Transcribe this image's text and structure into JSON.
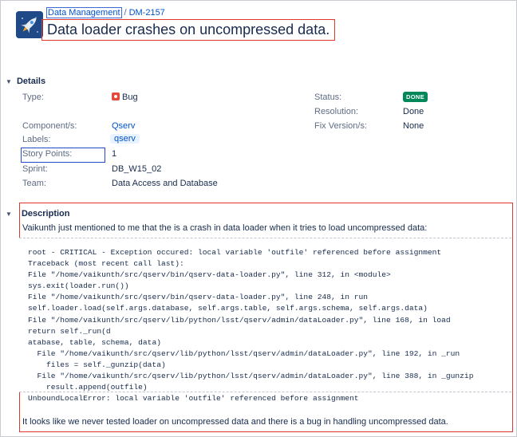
{
  "breadcrumb": {
    "project": "Data Management",
    "separator": "/",
    "issue_key": "DM-2157"
  },
  "issue": {
    "title": "Data loader crashes on uncompressed data."
  },
  "details": {
    "heading": "Details",
    "type_label": "Type:",
    "type_value": "Bug",
    "component_label": "Component/s:",
    "component_value": "Qserv",
    "labels_label": "Labels:",
    "labels_value": "qserv",
    "story_points_label": "Story Points:",
    "story_points_value": "1",
    "sprint_label": "Sprint:",
    "sprint_value": "DB_W15_02",
    "team_label": "Team:",
    "team_value": "Data Access and Database",
    "status_label": "Status:",
    "status_value": "DONE",
    "resolution_label": "Resolution:",
    "resolution_value": "Done",
    "fix_label": "Fix Version/s:",
    "fix_value": "None"
  },
  "description": {
    "heading": "Description",
    "intro": "Vaikunth just mentioned to me that the is a crash in data loader when it tries to load uncompressed data:",
    "code_lines": [
      "root - CRITICAL - Exception occured: local variable 'outfile' referenced before assignment",
      "Traceback (most recent call last):",
      "File \"/home/vaikunth/src/qserv/bin/qserv-data-loader.py\", line 312, in <module>",
      "sys.exit(loader.run())",
      "File \"/home/vaikunth/src/qserv/bin/qserv-data-loader.py\", line 248, in run",
      "self.loader.load(self.args.database, self.args.table, self.args.schema, self.args.data)",
      "File \"/home/vaikunth/src/qserv/lib/python/lsst/qserv/admin/dataLoader.py\", line 168, in load",
      "return self._run(d",
      "atabase, table, schema, data)",
      "  File \"/home/vaikunth/src/qserv/lib/python/lsst/qserv/admin/dataLoader.py\", line 192, in _run",
      "    files = self._gunzip(data)",
      "  File \"/home/vaikunth/src/qserv/lib/python/lsst/qserv/admin/dataLoader.py\", line 388, in _gunzip",
      "    result.append(outfile)",
      "UnboundLocalError: local variable 'outfile' referenced before assignment"
    ],
    "outro": "It looks like we never tested loader on uncompressed data and there is a bug in handling uncompressed data."
  },
  "colors": {
    "accent": "#0052cc",
    "done_green": "#00875a",
    "bug_red": "#e5493a",
    "highlight_red": "#e0392b",
    "highlight_blue": "#1f4ac9"
  },
  "icons": {
    "project_avatar": "rocket-icon",
    "type_icon": "bug-icon",
    "collapse": "chevron-down-icon"
  }
}
